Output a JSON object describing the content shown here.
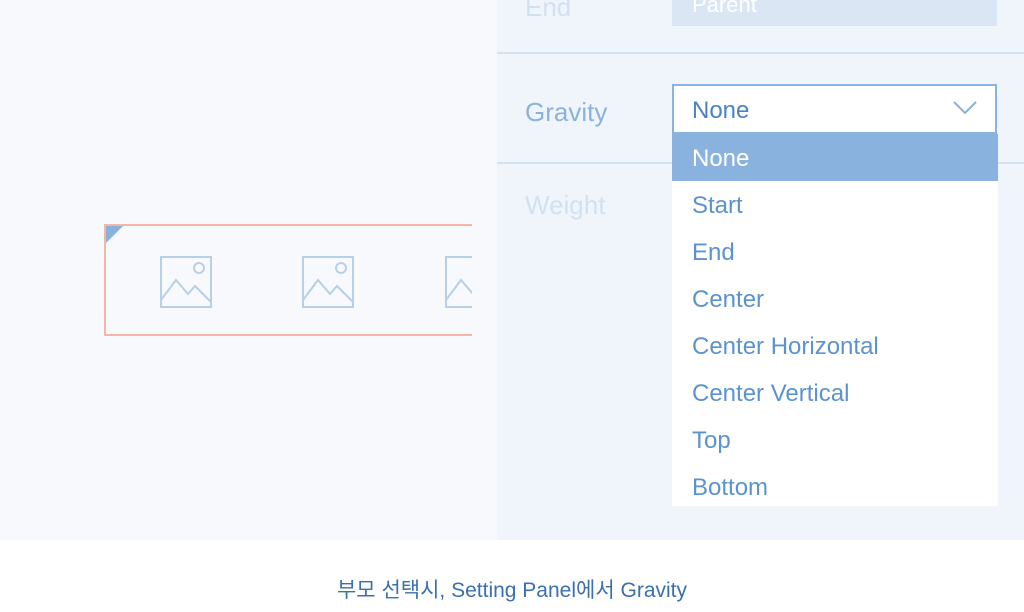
{
  "panel": {
    "end_row": {
      "label": "End",
      "field_value": "Parent"
    },
    "gravity": {
      "label": "Gravity",
      "selected_value": "None",
      "options": [
        "None",
        "Start",
        "End",
        "Center",
        "Center Horizontal",
        "Center Vertical",
        "Top",
        "Bottom"
      ]
    },
    "weight": {
      "label": "Weight"
    }
  },
  "preview": {
    "icons": [
      "image-placeholder-icon",
      "image-placeholder-icon",
      "image-placeholder-icon"
    ]
  },
  "caption": "부모 선택시, Setting Panel에서 Gravity",
  "colors": {
    "accent": "#8ab2de",
    "option_text": "#5b93d0",
    "preview_border": "#f4b6a6",
    "caption": "#3a70ae"
  }
}
